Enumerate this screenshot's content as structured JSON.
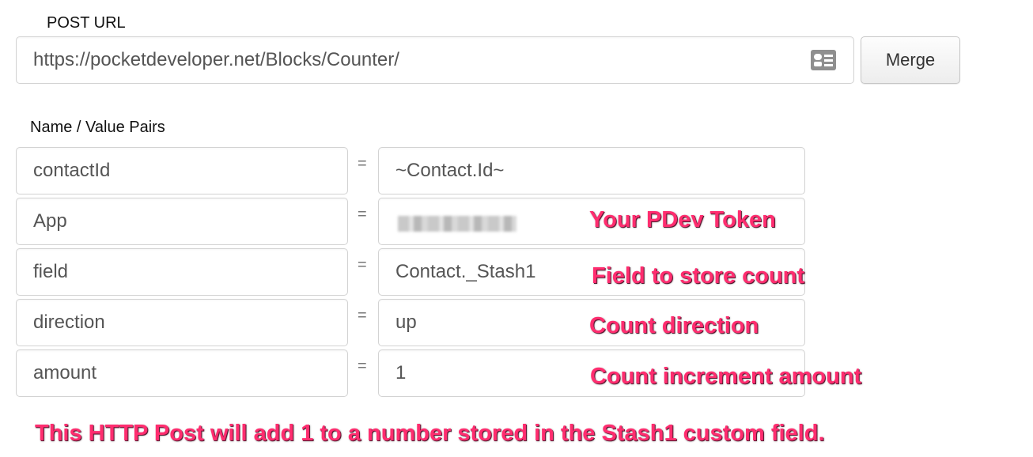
{
  "post_url": {
    "label": "POST URL",
    "value": "https://pocketdeveloper.net/Blocks/Counter/",
    "card_icon": "contact-card-icon",
    "merge_label": "Merge"
  },
  "pairs": {
    "label": "Name / Value Pairs",
    "equals": "=",
    "rows": [
      {
        "name": "contactId",
        "value": "~Contact.Id~"
      },
      {
        "name": "App",
        "value": ""
      },
      {
        "name": "field",
        "value": "Contact._Stash1"
      },
      {
        "name": "direction",
        "value": "up"
      },
      {
        "name": "amount",
        "value": "1"
      }
    ]
  },
  "annotations": {
    "token": "Your PDev Token",
    "field": "Field to store count",
    "direction": "Count direction",
    "amount": "Count increment amount",
    "summary": "This HTTP Post will add 1 to a number stored in the Stash1 custom field."
  },
  "colors": {
    "annotation": "#ff2d6f",
    "border": "#d3d3d3"
  }
}
